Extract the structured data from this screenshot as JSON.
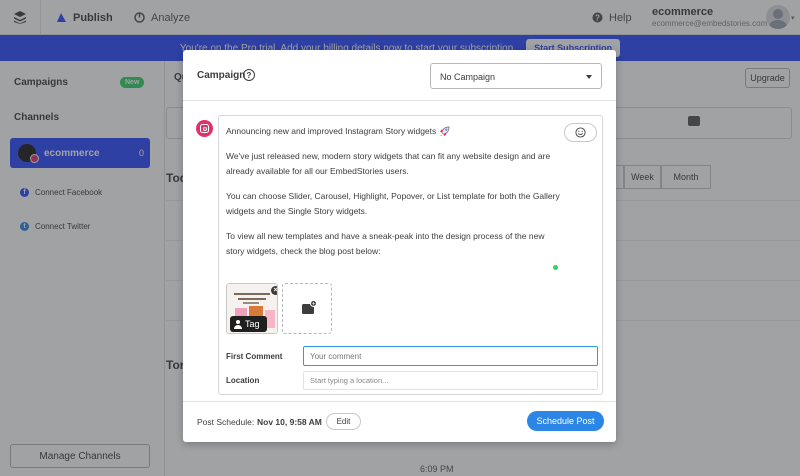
{
  "topbar": {
    "nav": [
      {
        "label": "Publish"
      },
      {
        "label": "Analyze"
      }
    ],
    "help_label": "Help",
    "user_name": "ecommerce",
    "user_email": "ecommerce@embedstories.com"
  },
  "trial_banner": {
    "text": "You're on the Pro trial. Add your billing details now to start your subscription.",
    "button_label": "Start Subscription"
  },
  "sidebar": {
    "campaigns_label": "Campaigns",
    "new_badge": "New",
    "channels_label": "Channels",
    "channel": {
      "name": "ecommerce",
      "count": "0"
    },
    "connect_facebook": "Connect Facebook",
    "connect_twitter": "Connect Twitter",
    "manage_label": "Manage Channels"
  },
  "main": {
    "tab_label": "Qu",
    "upgrade_label": "Upgrade",
    "week_label": "Week",
    "month_label": "Month",
    "today_label": "Tod",
    "tomorrow_label": "Tom",
    "time_label": "6:09 PM"
  },
  "modal": {
    "campaign_label": "Campaign",
    "campaign_value": "No Campaign",
    "post_paragraphs": [
      "Announcing new and improved Instagram Story widgets",
      "We've just released new, modern story widgets that can fit any website design and are already available for all our EmbedStories users.",
      "You can choose Slider, Carousel, Highlight, Popover, or List template for both the Gallery widgets and the Single Story widgets.",
      "To view all new templates and have a sneak-peak into the design process of the new story widgets, check the blog post below:"
    ],
    "tag_label": "Tag",
    "first_comment_label": "First Comment",
    "first_comment_placeholder": "Your comment",
    "location_label": "Location",
    "location_placeholder": "Start typing a location...",
    "schedule_label": "Post Schedule:",
    "schedule_date": "Nov 10, 9:58 AM",
    "edit_label": "Edit",
    "schedule_button": "Schedule Post"
  },
  "colors": {
    "brand_blue": "#2c4bff",
    "schedule_blue": "#2c86e5",
    "instagram_pink": "#e1306c",
    "success_green": "#2fd566"
  }
}
